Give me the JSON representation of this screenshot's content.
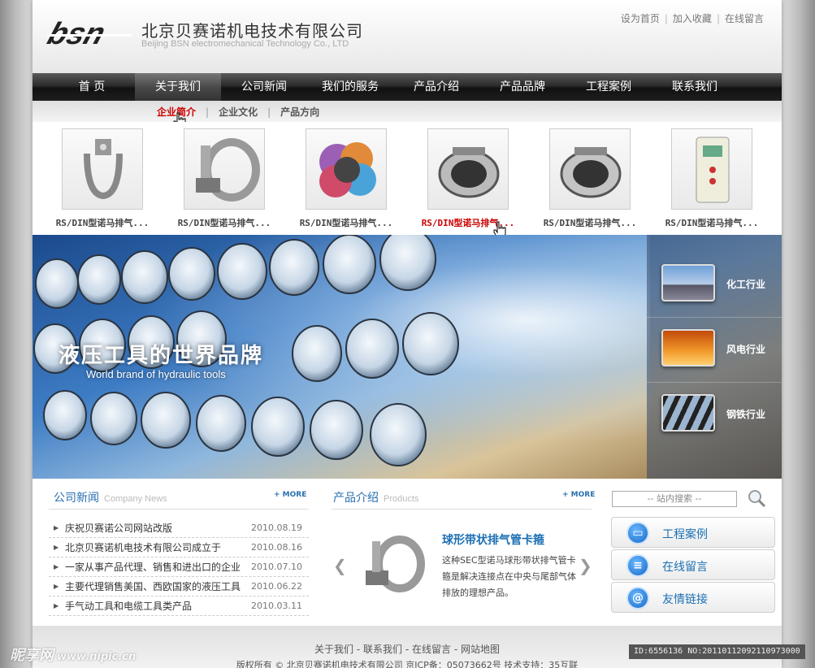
{
  "header": {
    "company_cn": "北京贝赛诺机电技术有限公司",
    "company_en": "Beijing BSN electromechanical Technology Co., LTD",
    "logo_text": "bsn",
    "top_links": [
      "设为首页",
      "加入收藏",
      "在线留言"
    ]
  },
  "nav": {
    "items": [
      "首 页",
      "关于我们",
      "公司新闻",
      "我们的服务",
      "产品介绍",
      "产品品牌",
      "工程案例",
      "联系我们"
    ],
    "active_index": 1
  },
  "subnav": {
    "items": [
      "企业简介",
      "企业文化",
      "产品方向"
    ],
    "active_index": 0
  },
  "products_strip": [
    {
      "caption": "RS/DIN型诺马排气...",
      "icon": "clamp-single-icon"
    },
    {
      "caption": "RS/DIN型诺马排气...",
      "icon": "clamp-bolt-icon"
    },
    {
      "caption": "RS/DIN型诺马排气...",
      "icon": "color-caps-icon"
    },
    {
      "caption": "RS/DIN型诺马排气...",
      "icon": "pipe-coupling-icon",
      "highlight": true
    },
    {
      "caption": "RS/DIN型诺马排气...",
      "icon": "pipe-coupling-icon"
    },
    {
      "caption": "RS/DIN型诺马排气...",
      "icon": "controller-device-icon"
    }
  ],
  "banner": {
    "title": "液压工具的世界品牌",
    "subtitle": "World brand of hydraulic tools",
    "industries": [
      "化工行业",
      "风电行业",
      "钢铁行业"
    ]
  },
  "news": {
    "title": "公司新闻",
    "title_en": "Company News",
    "more": "+ MORE",
    "items": [
      {
        "text": "庆祝贝赛诺公司网站改版",
        "date": "2010.08.19"
      },
      {
        "text": "北京贝赛诺机电技术有限公司成立于",
        "date": "2010.08.16"
      },
      {
        "text": "一家从事产品代理、销售和进出口的企业",
        "date": "2010.07.10"
      },
      {
        "text": "主要代理销售美国、西欧国家的液压工具",
        "date": "2010.06.22"
      },
      {
        "text": "手气动工具和电缆工具类产品",
        "date": "2010.03.11"
      }
    ]
  },
  "products": {
    "title": "产品介绍",
    "title_en": "Products",
    "more": "+ MORE",
    "feature_title": "球形带状排气管卡箍",
    "feature_desc": "这种SEC型诺马球形带状排气管卡箍是解决连接点在中央与尾部气体排放的理想产品。",
    "prev": "❮",
    "next": "❯"
  },
  "sidebar": {
    "search_placeholder": "-- 站内搜索 --",
    "buttons": [
      "工程案例",
      "在线留言",
      "友情链接"
    ]
  },
  "footer": {
    "links": [
      "关于我们",
      "联系我们",
      "在线留言",
      "网站地图"
    ],
    "copyright": "版权所有 © 北京贝赛诺机电技术有限公司 京ICP备：05073662号 技术支持：35互联"
  },
  "watermark": {
    "left": "昵享网",
    "url": "www.nipic.cn",
    "id": "ID:6556136 NO:20110112092110973000"
  },
  "colors": {
    "accent_blue": "#1b6fb3",
    "active_red": "#cc0000",
    "nav_dark": "#1e1e1e"
  }
}
